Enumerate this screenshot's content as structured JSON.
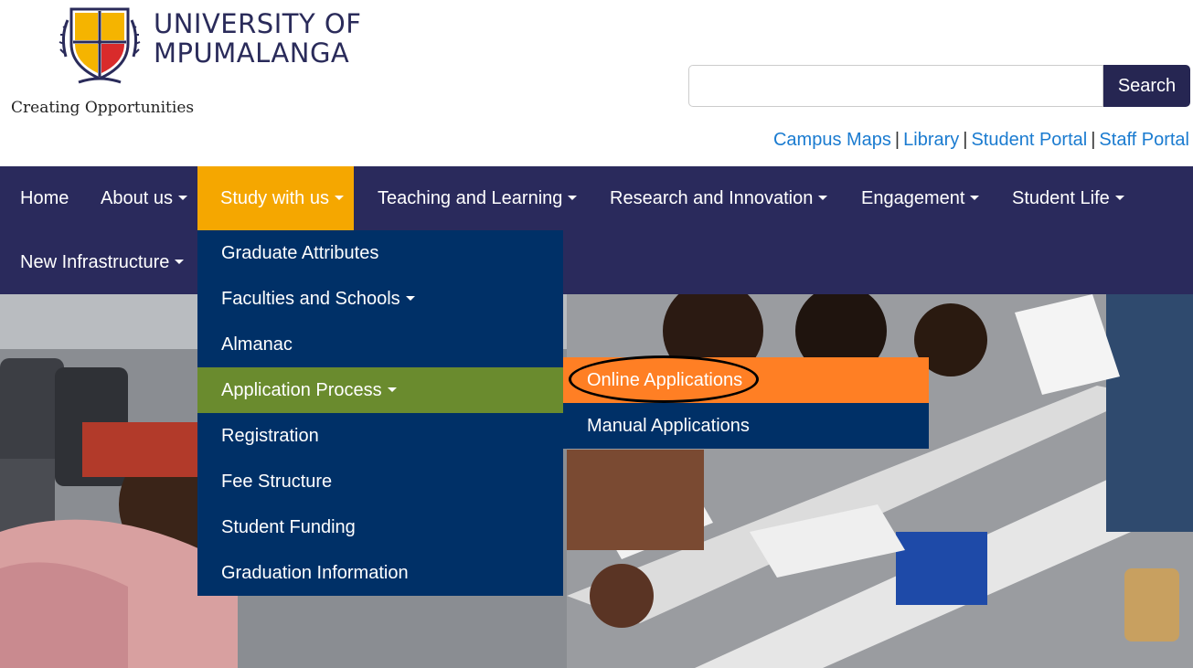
{
  "header": {
    "name_line1": "UNIVERSITY OF",
    "name_line2": "MPUMALANGA",
    "tagline": "Creating Opportunities"
  },
  "search": {
    "placeholder": "",
    "button_label": "Search"
  },
  "quick_links": {
    "items": [
      "Campus Maps",
      "Library",
      "Student Portal",
      "Staff Portal"
    ],
    "separator": "|"
  },
  "nav": {
    "items": [
      {
        "label": "Home"
      },
      {
        "label": "About us"
      },
      {
        "label": "Study with us"
      },
      {
        "label": "Teaching and Learning"
      },
      {
        "label": "Research and Innovation"
      },
      {
        "label": "Engagement"
      },
      {
        "label": "Student Life"
      },
      {
        "label": "New Infrastructure"
      }
    ],
    "active": "Study with us"
  },
  "dropdown": {
    "items": [
      {
        "label": "Graduate Attributes"
      },
      {
        "label": "Faculties and Schools"
      },
      {
        "label": "Almanac"
      },
      {
        "label": "Application Process"
      },
      {
        "label": "Registration"
      },
      {
        "label": "Fee Structure"
      },
      {
        "label": "Student Funding"
      },
      {
        "label": "Graduation Information"
      }
    ]
  },
  "submenu": {
    "items": [
      {
        "label": "Online Applications"
      },
      {
        "label": "Manual Applications"
      }
    ]
  },
  "colors": {
    "navbar": "#2a2a5c",
    "nav_active": "#f5a700",
    "dropdown": "#003067",
    "dropdown_active": "#6a8b2e",
    "submenu_active": "#ff7f24",
    "link": "#1a7bd0",
    "search_button": "#262652"
  }
}
